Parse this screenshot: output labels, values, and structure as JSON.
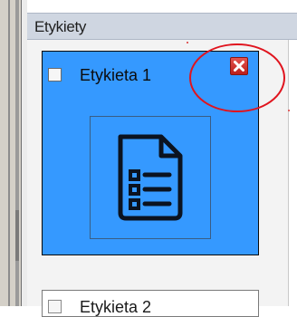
{
  "panel": {
    "title": "Etykiety"
  },
  "labels": [
    {
      "name": "Etykieta 1",
      "checked": false,
      "selected": true
    },
    {
      "name": "Etykieta 2",
      "checked": false,
      "selected": false
    }
  ],
  "icons": {
    "close": "close-icon",
    "document": "document-list-icon"
  },
  "colors": {
    "selected_background": "#3599ff",
    "close_button": "#d83a34",
    "header_background": "#cfd6e1",
    "highlight_circle": "#e0141e"
  }
}
